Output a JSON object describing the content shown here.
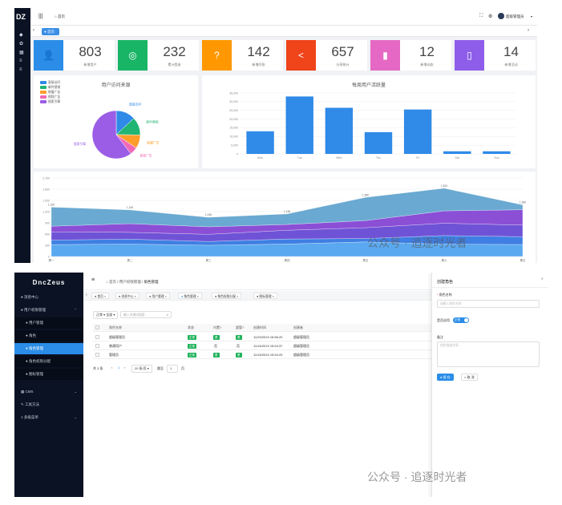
{
  "dashboard": {
    "logo": "DZ",
    "breadcrumb": "首页",
    "user_name": "超级管理员",
    "home_tab": "首页",
    "stats": [
      {
        "value": "803",
        "label": "新增用户",
        "color": "#2b8de8",
        "icon": "user-add-icon",
        "glyph": "👤"
      },
      {
        "value": "232",
        "label": "累计登录",
        "color": "#18b566",
        "icon": "target-icon",
        "glyph": "◎"
      },
      {
        "value": "142",
        "label": "新增问答",
        "color": "#ff9800",
        "icon": "question-icon",
        "glyph": "?"
      },
      {
        "value": "657",
        "label": "分享统计",
        "color": "#f0441a",
        "icon": "share-icon",
        "glyph": "<"
      },
      {
        "value": "12",
        "label": "新增动态",
        "color": "#e569c4",
        "icon": "book-icon",
        "glyph": "▮"
      },
      {
        "value": "14",
        "label": "新增活动",
        "color": "#8e5eea",
        "icon": "map-icon",
        "glyph": "▯"
      }
    ],
    "pie_title": "用户访问来源",
    "pie_legend": [
      "直接访问",
      "邮件营销",
      "联盟广告",
      "视频广告",
      "搜索引擎"
    ],
    "pie_colors": [
      "#2f8ae8",
      "#20b573",
      "#ff9d2a",
      "#f06ab8",
      "#9b5de6"
    ],
    "bar_title": "每周用户活跃量"
  },
  "chart_data": [
    {
      "type": "pie",
      "title": "用户访问来源",
      "labels": [
        "直接访问",
        "邮件营销",
        "联盟广告",
        "视频广告",
        "搜索引擎"
      ],
      "values": [
        335,
        310,
        234,
        135,
        1548
      ]
    },
    {
      "type": "bar",
      "title": "每周用户活跃量",
      "categories": [
        "Mon",
        "Tue",
        "Wed",
        "Thu",
        "Fri",
        "Sat",
        "Sun"
      ],
      "values": [
        13000,
        33000,
        26500,
        12500,
        25500,
        1500,
        1500
      ],
      "ylim": [
        0,
        35000
      ],
      "yticks": [
        "0",
        "5,000",
        "10,000",
        "15,000",
        "20,000",
        "25,000",
        "30,000",
        "35,000"
      ]
    },
    {
      "type": "area",
      "categories": [
        "周一",
        "周二",
        "周三",
        "周四",
        "周五",
        "周六",
        "周日"
      ],
      "ylim": [
        0,
        2100
      ],
      "yticks": [
        "0",
        "300",
        "600",
        "900",
        "1,200",
        "1,500",
        "1,800",
        "2,100"
      ],
      "top_labels": [
        "1,320",
        "1,245",
        "1,046",
        "1,138",
        "1,580",
        "1,824",
        "1,380"
      ],
      "series": [
        {
          "values": [
            320,
            332,
            301,
            334,
            390,
            330,
            320
          ],
          "color": "#5aa9f0"
        },
        {
          "values": [
            120,
            132,
            101,
            134,
            90,
            230,
            210
          ],
          "color": "#3f7fe3"
        },
        {
          "values": [
            220,
            182,
            191,
            234,
            290,
            330,
            310
          ],
          "color": "#6f53d6"
        },
        {
          "values": [
            150,
            232,
            201,
            154,
            190,
            330,
            410
          ],
          "color": "#8b4fd6"
        },
        {
          "values": [
            510,
            367,
            253,
            282,
            620,
            604,
            130
          ],
          "color": "#6aa9d1"
        }
      ]
    }
  ],
  "admin": {
    "logo": "DncZeus",
    "menu": [
      {
        "label": "消息中心",
        "icon": "bell-icon",
        "glyph": "🔔"
      },
      {
        "label": "用户权限管理",
        "icon": "lock-icon",
        "glyph": "🔒"
      },
      {
        "label": "用户管理",
        "icon": "user-icon",
        "glyph": "●"
      },
      {
        "label": "角色",
        "icon": "role-icon",
        "glyph": "●"
      },
      {
        "label": "角色管理",
        "icon": "user-group-icon",
        "glyph": "●"
      },
      {
        "label": "角色权限分配",
        "icon": "assign-icon",
        "glyph": "●"
      },
      {
        "label": "图标管理",
        "icon": "image-icon",
        "glyph": "●"
      },
      {
        "label": "CMS",
        "icon": "cms-icon",
        "glyph": "▦"
      },
      {
        "label": "工具方法",
        "icon": "tool-icon",
        "glyph": "✎"
      },
      {
        "label": "多级菜单",
        "icon": "menu-icon",
        "glyph": "≡"
      }
    ],
    "breadcrumbs": [
      "首页",
      "用户权限管理",
      "角色管理"
    ],
    "tabs": [
      "首页",
      "消息中心",
      "用户管理",
      "角色管理",
      "角色权限分配",
      "图标管理"
    ],
    "filter_select": "全部",
    "search_placeholder": "输入关键词搜索...",
    "columns": [
      "角色名称",
      "状态",
      "内置?",
      "超管?",
      "创建时间",
      "创建者"
    ],
    "rows": [
      {
        "name": "超级管理员",
        "status": "正常",
        "builtin": "是",
        "super": "是",
        "time": "11/29/2019 16:56:20",
        "creator": "超级管理员"
      },
      {
        "name": "普通用户",
        "status": "正常",
        "builtin": "否",
        "super": "否",
        "time": "11/16/2019 15:54:37",
        "creator": "超级管理员"
      },
      {
        "name": "管理员",
        "status": "正常",
        "builtin": "是",
        "super": "是",
        "time": "11/16/2019 15:54:29",
        "creator": "超级管理员"
      }
    ],
    "pager": {
      "total": "共 3 条",
      "page": "1",
      "page_size": "20 条/页",
      "goto": "跳至",
      "goto_value": "1",
      "goto_unit": "页"
    },
    "drawer": {
      "title": "创建角色",
      "name_label": "角色名称",
      "name_placeholder": "请输入角色名称",
      "status_label": "是否启用",
      "status_value": "正常",
      "desc_label": "备注",
      "desc_placeholder": "角色描述信息...",
      "save": "保 存",
      "cancel": "取 消"
    }
  },
  "watermark": "公众号 · 追逐时光者"
}
